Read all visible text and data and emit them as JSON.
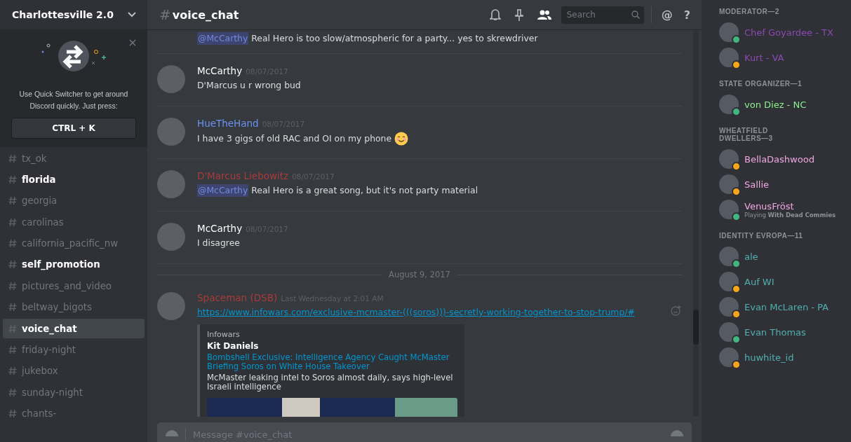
{
  "server": {
    "name": "Charlottesville 2.0"
  },
  "quick_switcher": {
    "text": "Use Quick Switcher to get around Discord quickly. Just press:",
    "shortcut": "CTRL + K"
  },
  "channels": [
    {
      "name": "tx_ok",
      "unread": false,
      "selected": false
    },
    {
      "name": "florida",
      "unread": true,
      "selected": false
    },
    {
      "name": "georgia",
      "unread": false,
      "selected": false
    },
    {
      "name": "carolinas",
      "unread": false,
      "selected": false
    },
    {
      "name": "california_pacific_nw",
      "unread": false,
      "selected": false
    },
    {
      "name": "self_promotion",
      "unread": true,
      "selected": false
    },
    {
      "name": "pictures_and_video",
      "unread": false,
      "selected": false
    },
    {
      "name": "beltway_bigots",
      "unread": false,
      "selected": false
    },
    {
      "name": "voice_chat",
      "unread": true,
      "selected": true
    },
    {
      "name": "friday-night",
      "unread": false,
      "selected": false
    },
    {
      "name": "jukebox",
      "unread": false,
      "selected": false
    },
    {
      "name": "sunday-night",
      "unread": false,
      "selected": false
    },
    {
      "name": "chants-",
      "unread": false,
      "selected": false
    }
  ],
  "channel_header": {
    "hash": "#",
    "name": "voice_chat"
  },
  "search": {
    "placeholder": "Search"
  },
  "header_buttons": [
    "@",
    "?"
  ],
  "messages": [
    {
      "kind": "continued",
      "parts": [
        {
          "kind": "mention",
          "text": "@McCarthy"
        },
        {
          "kind": "text",
          "text": " Real Hero is too slow/atmospheric for a party... yes to skrewdriver"
        }
      ]
    },
    {
      "kind": "message",
      "author": "McCarthy",
      "color": "#ffffff",
      "time": "08/07/2017",
      "parts": [
        {
          "kind": "text",
          "text": "D'Marcus u r wrong bud"
        }
      ]
    },
    {
      "kind": "message",
      "author": "HueTheHand",
      "color": "#6d93f0",
      "time": "08/07/2017",
      "parts": [
        {
          "kind": "text",
          "text": "I have 3 gigs of old RAC and OI on my phone"
        }
      ],
      "emoji": true
    },
    {
      "kind": "message",
      "author": "D'Marcus Liebowitz",
      "color": "#a83c3c",
      "time": "08/07/2017",
      "parts": [
        {
          "kind": "mention",
          "text": "@McCarthy"
        },
        {
          "kind": "text",
          "text": " Real Hero is a great song, but it's not party material"
        }
      ]
    },
    {
      "kind": "message",
      "author": "McCarthy",
      "color": "#ffffff",
      "time": "08/07/2017",
      "parts": [
        {
          "kind": "text",
          "text": "I disagree"
        }
      ]
    },
    {
      "kind": "divider",
      "text": "August 9, 2017"
    },
    {
      "kind": "message",
      "author": "Spaceman (DSB)",
      "color": "#a83c3c",
      "time": "Last Wednesday at 2:01 AM",
      "parts": [
        {
          "kind": "link",
          "text": "https://www.infowars.com/exclusive-mcmaster-(((soros)))-secretly-working-together-to-stop-trump/#"
        }
      ],
      "embed": {
        "provider": "Infowars",
        "author": "Kit Daniels",
        "title": "Bombshell Exclusive: Intelligence Agency Caught McMaster Briefing Soros on White House Takeover",
        "description": "McMaster leaking intel to Soros almost daily, says high-level Israeli intelligence"
      }
    }
  ],
  "composer": {
    "placeholder": "Message #voice_chat"
  },
  "member_groups": [
    {
      "title": "MODERATOR—2",
      "color": "#8a4ab0",
      "members": [
        {
          "name": "Chef Goyardee - TX",
          "color": "#43b581"
        },
        {
          "name": "Kurt - VA",
          "color": "#faa61a"
        }
      ]
    },
    {
      "title": "STATE ORGANIZER—1",
      "color": "#8ef08e",
      "members": [
        {
          "name": "von Diez - NC",
          "color": "#43b581"
        }
      ]
    },
    {
      "title": "WHEATFIELD DWELLERS—3",
      "color": "#f0a8e0",
      "members": [
        {
          "name": "BellaDashwood",
          "color": "#faa61a"
        },
        {
          "name": "Sallie",
          "color": "#faa61a"
        },
        {
          "name": "VenusFröst",
          "color": "#43b581",
          "activity": "Playing **With Dead Commies**"
        }
      ]
    },
    {
      "title": "IDENTITY EVROPA—11",
      "color": "#4fb0b0",
      "members": [
        {
          "name": "ale",
          "color": "#43b581"
        },
        {
          "name": "Auf WI",
          "color": "#faa61a"
        },
        {
          "name": "Evan McLaren - PA",
          "color": "#faa61a"
        },
        {
          "name": "Evan Thomas",
          "color": "#43b581"
        },
        {
          "name": "huwhite_id",
          "color": "#faa61a"
        }
      ]
    }
  ]
}
